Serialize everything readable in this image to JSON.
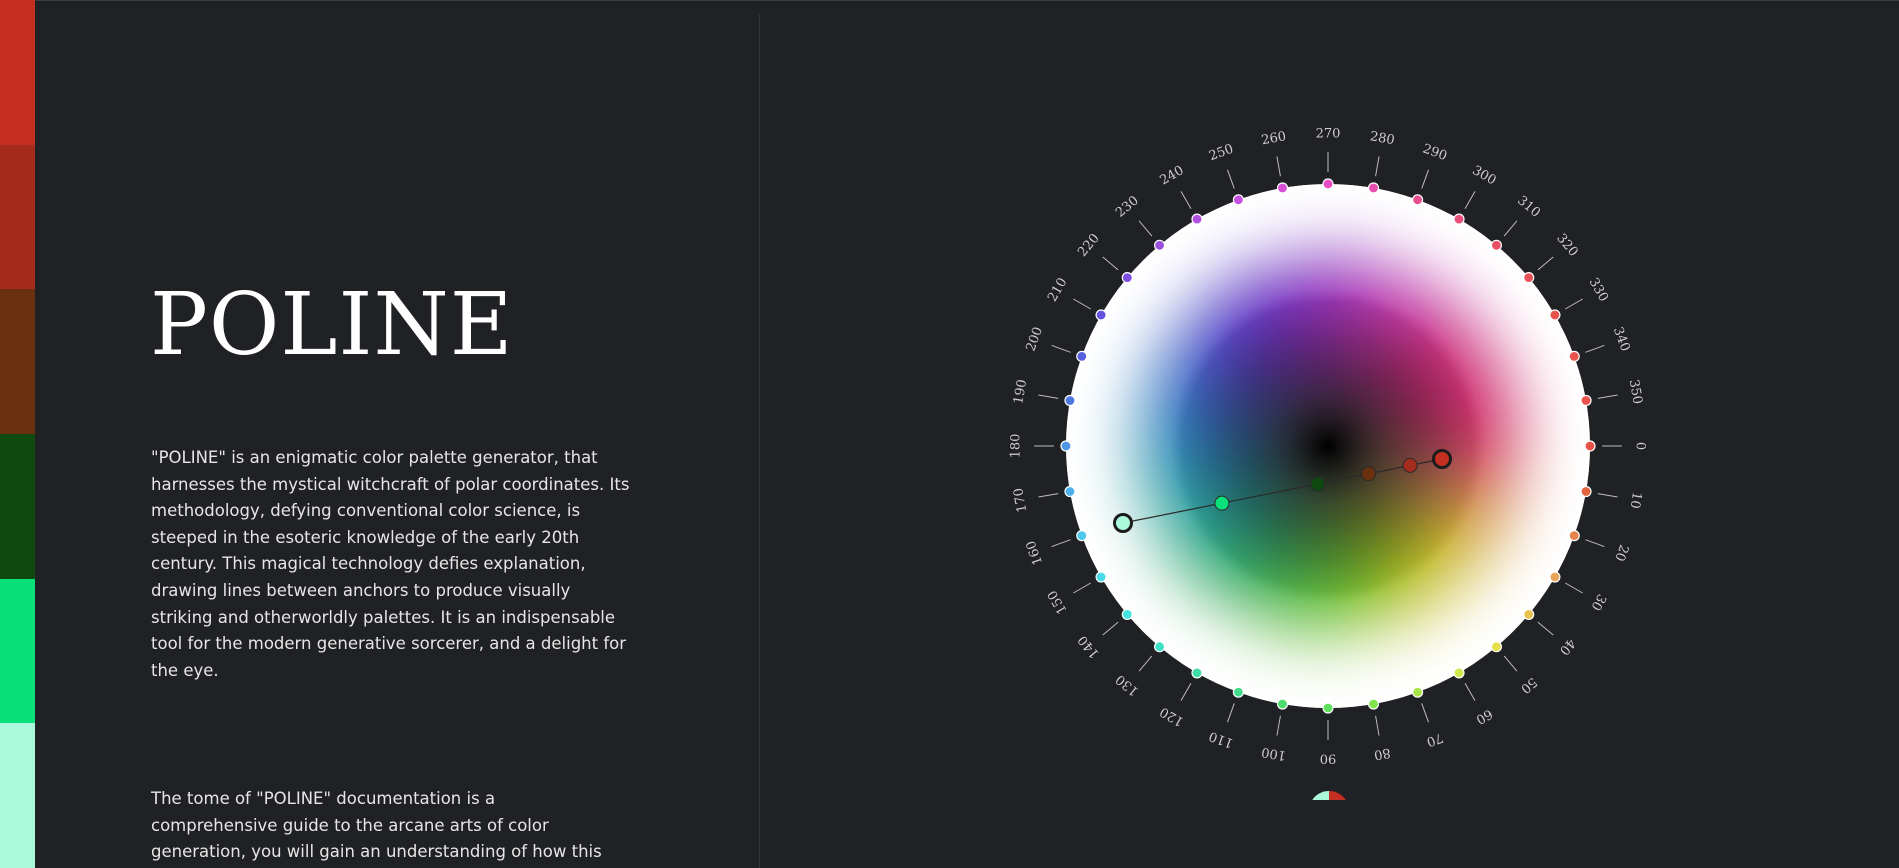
{
  "palette": {
    "swatches": [
      "#c42f22",
      "#a32c1d",
      "#6b310f",
      "#0e4a10",
      "#08e17a",
      "#aaf9dd"
    ]
  },
  "hero": {
    "title": "POLINE",
    "description": "\"POLINE\" is an enigmatic color palette generator, that harnesses the mystical witchcraft of polar coordinates. Its methodology, defying conventional color science, is steeped in the esoteric knowledge of the early 20th century. This magical technology defies explanation, drawing lines between anchors to produce visually striking and otherworldly palettes. It is an indispensable tool for the modern generative sorcerer, and a delight for the eye.",
    "docs_intro": "The tome of \"POLINE\" documentation is a comprehensive guide to the arcane arts of color generation, you will gain an understanding of how this"
  },
  "wheel": {
    "degree_labels": [
      "0",
      "10",
      "20",
      "30",
      "40",
      "50",
      "60",
      "70",
      "80",
      "90",
      "100",
      "110",
      "120",
      "130",
      "140",
      "150",
      "160",
      "170",
      "180",
      "190",
      "200",
      "210",
      "220",
      "230",
      "240",
      "250",
      "260",
      "270",
      "280",
      "290",
      "300",
      "310",
      "320",
      "330",
      "340",
      "350"
    ],
    "rim_colors": [
      "#e8524a",
      "#e4643f",
      "#e6844d",
      "#eba45b",
      "#e6c24e",
      "#e5e04a",
      "#cfe84b",
      "#a9e64a",
      "#83e34c",
      "#5fe05c",
      "#4bdc6d",
      "#44dc8a",
      "#3fdca8",
      "#40e0c6",
      "#45e2de",
      "#4adbe9",
      "#4cc9ec",
      "#4fb1ec",
      "#4f96e6",
      "#4f78df",
      "#5660df",
      "#6452e1",
      "#7e4fde",
      "#9a4fdd",
      "#b14fe0",
      "#c54fde",
      "#d84fd6",
      "#e14fc3",
      "#e54fab",
      "#e84f91",
      "#ea4f78",
      "#e94f65",
      "#e8505a",
      "#e8524a",
      "#e8524a",
      "#e8524a"
    ],
    "palette_points": [
      "#aaf9dd",
      "#08e17a",
      "#0e4a10",
      "#6b310f",
      "#a32c1d",
      "#c42f22"
    ]
  }
}
